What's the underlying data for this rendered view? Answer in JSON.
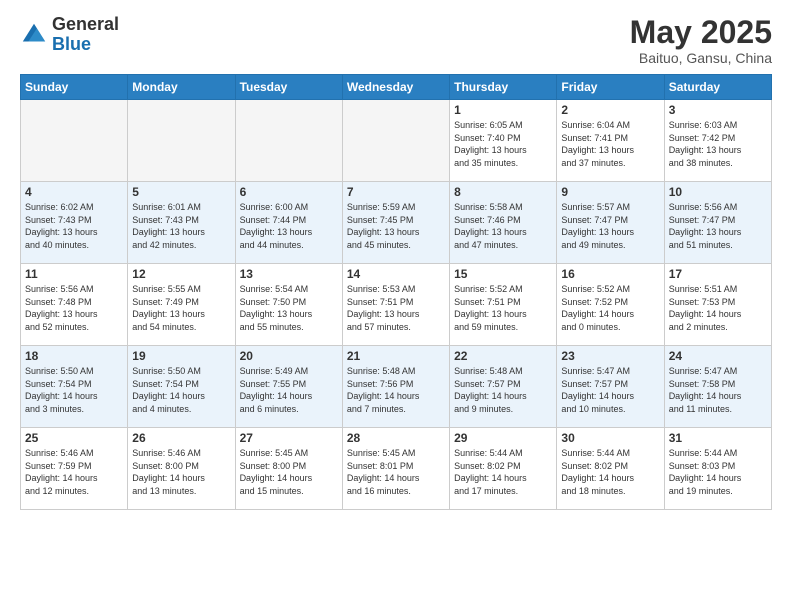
{
  "header": {
    "logo_line1": "General",
    "logo_line2": "Blue",
    "month": "May 2025",
    "location": "Baituo, Gansu, China"
  },
  "weekdays": [
    "Sunday",
    "Monday",
    "Tuesday",
    "Wednesday",
    "Thursday",
    "Friday",
    "Saturday"
  ],
  "weeks": [
    [
      {
        "day": "",
        "info": ""
      },
      {
        "day": "",
        "info": ""
      },
      {
        "day": "",
        "info": ""
      },
      {
        "day": "",
        "info": ""
      },
      {
        "day": "1",
        "info": "Sunrise: 6:05 AM\nSunset: 7:40 PM\nDaylight: 13 hours\nand 35 minutes."
      },
      {
        "day": "2",
        "info": "Sunrise: 6:04 AM\nSunset: 7:41 PM\nDaylight: 13 hours\nand 37 minutes."
      },
      {
        "day": "3",
        "info": "Sunrise: 6:03 AM\nSunset: 7:42 PM\nDaylight: 13 hours\nand 38 minutes."
      }
    ],
    [
      {
        "day": "4",
        "info": "Sunrise: 6:02 AM\nSunset: 7:43 PM\nDaylight: 13 hours\nand 40 minutes."
      },
      {
        "day": "5",
        "info": "Sunrise: 6:01 AM\nSunset: 7:43 PM\nDaylight: 13 hours\nand 42 minutes."
      },
      {
        "day": "6",
        "info": "Sunrise: 6:00 AM\nSunset: 7:44 PM\nDaylight: 13 hours\nand 44 minutes."
      },
      {
        "day": "7",
        "info": "Sunrise: 5:59 AM\nSunset: 7:45 PM\nDaylight: 13 hours\nand 45 minutes."
      },
      {
        "day": "8",
        "info": "Sunrise: 5:58 AM\nSunset: 7:46 PM\nDaylight: 13 hours\nand 47 minutes."
      },
      {
        "day": "9",
        "info": "Sunrise: 5:57 AM\nSunset: 7:47 PM\nDaylight: 13 hours\nand 49 minutes."
      },
      {
        "day": "10",
        "info": "Sunrise: 5:56 AM\nSunset: 7:47 PM\nDaylight: 13 hours\nand 51 minutes."
      }
    ],
    [
      {
        "day": "11",
        "info": "Sunrise: 5:56 AM\nSunset: 7:48 PM\nDaylight: 13 hours\nand 52 minutes."
      },
      {
        "day": "12",
        "info": "Sunrise: 5:55 AM\nSunset: 7:49 PM\nDaylight: 13 hours\nand 54 minutes."
      },
      {
        "day": "13",
        "info": "Sunrise: 5:54 AM\nSunset: 7:50 PM\nDaylight: 13 hours\nand 55 minutes."
      },
      {
        "day": "14",
        "info": "Sunrise: 5:53 AM\nSunset: 7:51 PM\nDaylight: 13 hours\nand 57 minutes."
      },
      {
        "day": "15",
        "info": "Sunrise: 5:52 AM\nSunset: 7:51 PM\nDaylight: 13 hours\nand 59 minutes."
      },
      {
        "day": "16",
        "info": "Sunrise: 5:52 AM\nSunset: 7:52 PM\nDaylight: 14 hours\nand 0 minutes."
      },
      {
        "day": "17",
        "info": "Sunrise: 5:51 AM\nSunset: 7:53 PM\nDaylight: 14 hours\nand 2 minutes."
      }
    ],
    [
      {
        "day": "18",
        "info": "Sunrise: 5:50 AM\nSunset: 7:54 PM\nDaylight: 14 hours\nand 3 minutes."
      },
      {
        "day": "19",
        "info": "Sunrise: 5:50 AM\nSunset: 7:54 PM\nDaylight: 14 hours\nand 4 minutes."
      },
      {
        "day": "20",
        "info": "Sunrise: 5:49 AM\nSunset: 7:55 PM\nDaylight: 14 hours\nand 6 minutes."
      },
      {
        "day": "21",
        "info": "Sunrise: 5:48 AM\nSunset: 7:56 PM\nDaylight: 14 hours\nand 7 minutes."
      },
      {
        "day": "22",
        "info": "Sunrise: 5:48 AM\nSunset: 7:57 PM\nDaylight: 14 hours\nand 9 minutes."
      },
      {
        "day": "23",
        "info": "Sunrise: 5:47 AM\nSunset: 7:57 PM\nDaylight: 14 hours\nand 10 minutes."
      },
      {
        "day": "24",
        "info": "Sunrise: 5:47 AM\nSunset: 7:58 PM\nDaylight: 14 hours\nand 11 minutes."
      }
    ],
    [
      {
        "day": "25",
        "info": "Sunrise: 5:46 AM\nSunset: 7:59 PM\nDaylight: 14 hours\nand 12 minutes."
      },
      {
        "day": "26",
        "info": "Sunrise: 5:46 AM\nSunset: 8:00 PM\nDaylight: 14 hours\nand 13 minutes."
      },
      {
        "day": "27",
        "info": "Sunrise: 5:45 AM\nSunset: 8:00 PM\nDaylight: 14 hours\nand 15 minutes."
      },
      {
        "day": "28",
        "info": "Sunrise: 5:45 AM\nSunset: 8:01 PM\nDaylight: 14 hours\nand 16 minutes."
      },
      {
        "day": "29",
        "info": "Sunrise: 5:44 AM\nSunset: 8:02 PM\nDaylight: 14 hours\nand 17 minutes."
      },
      {
        "day": "30",
        "info": "Sunrise: 5:44 AM\nSunset: 8:02 PM\nDaylight: 14 hours\nand 18 minutes."
      },
      {
        "day": "31",
        "info": "Sunrise: 5:44 AM\nSunset: 8:03 PM\nDaylight: 14 hours\nand 19 minutes."
      }
    ]
  ]
}
